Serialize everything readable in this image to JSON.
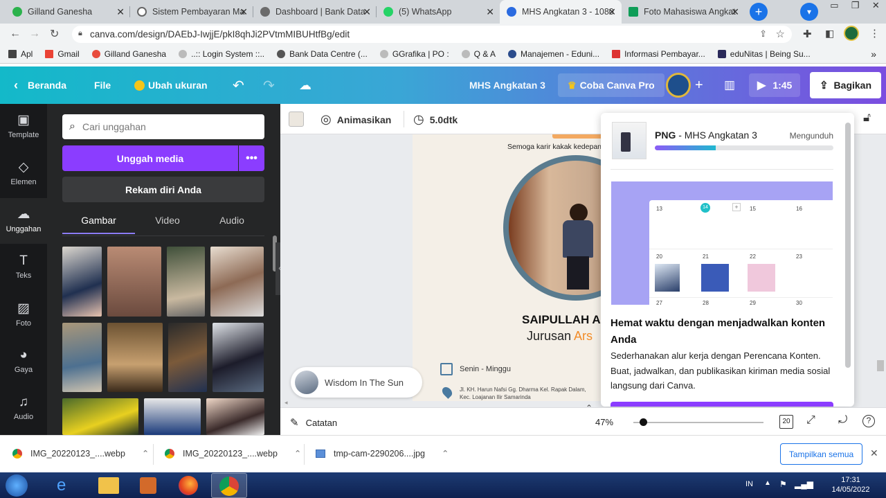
{
  "tabs": [
    {
      "label": "Gilland Ganesha",
      "color": "#2bb24c"
    },
    {
      "label": "Sistem Pembayaran Ma",
      "color": "#666"
    },
    {
      "label": "Dashboard | Bank Data",
      "color": "#666"
    },
    {
      "label": "(5) WhatsApp",
      "color": "#25d366"
    },
    {
      "label": "MHS Angkatan 3 - 1080",
      "color": "#2b6be0"
    },
    {
      "label": "Foto Mahasiswa Angkat",
      "color": "#0f9d58"
    }
  ],
  "address": {
    "url": "canva.com/design/DAEbJ-IwjjE/pkI8qhJi2PVtmMIBUHtfBg/edit"
  },
  "bookmarks": [
    "Apl",
    "Gmail",
    "Gilland Ganesha",
    "..:: Login System ::..",
    "Bank Data Centre (...",
    "GGrafika | PO :",
    "Q & A",
    "Manajemen - Eduni...",
    "Informasi Pembayar...",
    "eduNitas | Being Su..."
  ],
  "header": {
    "home": "Beranda",
    "file": "File",
    "resize": "Ubah ukuran",
    "title": "MHS Angkatan 3",
    "pro": "Coba Canva Pro",
    "duration": "1:45",
    "share": "Bagikan"
  },
  "rail": [
    {
      "label": "Template",
      "icon": "template-icon",
      "glyph": "▣"
    },
    {
      "label": "Elemen",
      "icon": "elements-icon",
      "glyph": "◇"
    },
    {
      "label": "Unggahan",
      "icon": "upload-icon",
      "glyph": "☁"
    },
    {
      "label": "Teks",
      "icon": "text-icon",
      "glyph": "T"
    },
    {
      "label": "Foto",
      "icon": "photo-icon",
      "glyph": "▨"
    },
    {
      "label": "Gaya",
      "icon": "style-icon",
      "glyph": "◕"
    },
    {
      "label": "Audio",
      "icon": "audio-icon",
      "glyph": "♫"
    }
  ],
  "panel": {
    "search_placeholder": "Cari unggahan",
    "upload": "Unggah media",
    "record": "Rekam diri Anda",
    "tabs": [
      "Gambar",
      "Video",
      "Audio"
    ]
  },
  "toolbar": {
    "animate": "Animasikan",
    "time": "5.0dtk"
  },
  "design": {
    "wish": "Semoga karir kakak kedepan",
    "name": "SAIPULLAH A",
    "major_prefix": "Jurusan ",
    "major_suffix": "Ars",
    "days": "Senin - Minggu",
    "address_line1": "Jl. KH. Harun Nafsi Gg. Dharma Kel. Rapak Dalam,",
    "address_line2": "Kec. Loajanan Ilir Samarinda",
    "audio_title": "Wisdom In The Sun"
  },
  "download_popup": {
    "format": "PNG",
    "file_name": "MHS Angkatan 3",
    "status": "Mengunduh",
    "progress": 0.34,
    "promo_title": "Hemat waktu dengan menjadwalkan konten Anda",
    "promo_body": "Sederhanakan alur kerja dengan Perencana Konten. Buat, jadwalkan, dan publikasikan kiriman media sosial langsung dari Canva.",
    "calendar": {
      "row1": [
        "13",
        "14",
        "15",
        "16"
      ],
      "row2": [
        "20",
        "21",
        "22",
        "23"
      ],
      "row3": [
        "27",
        "28",
        "29",
        "30"
      ]
    }
  },
  "bottom": {
    "notes": "Catatan",
    "zoom": "47%",
    "pages": "20"
  },
  "downloads": [
    {
      "name": "IMG_20220123_....webp"
    },
    {
      "name": "IMG_20220123_....webp"
    },
    {
      "name": "tmp-cam-2290206....jpg"
    }
  ],
  "show_all": "Tampilkan semua",
  "taskbar": {
    "lang": "IN",
    "time": "17:31",
    "date": "14/05/2022"
  },
  "colors": {
    "purple": "#8b3dff",
    "accent_orange": "#f28c28"
  }
}
